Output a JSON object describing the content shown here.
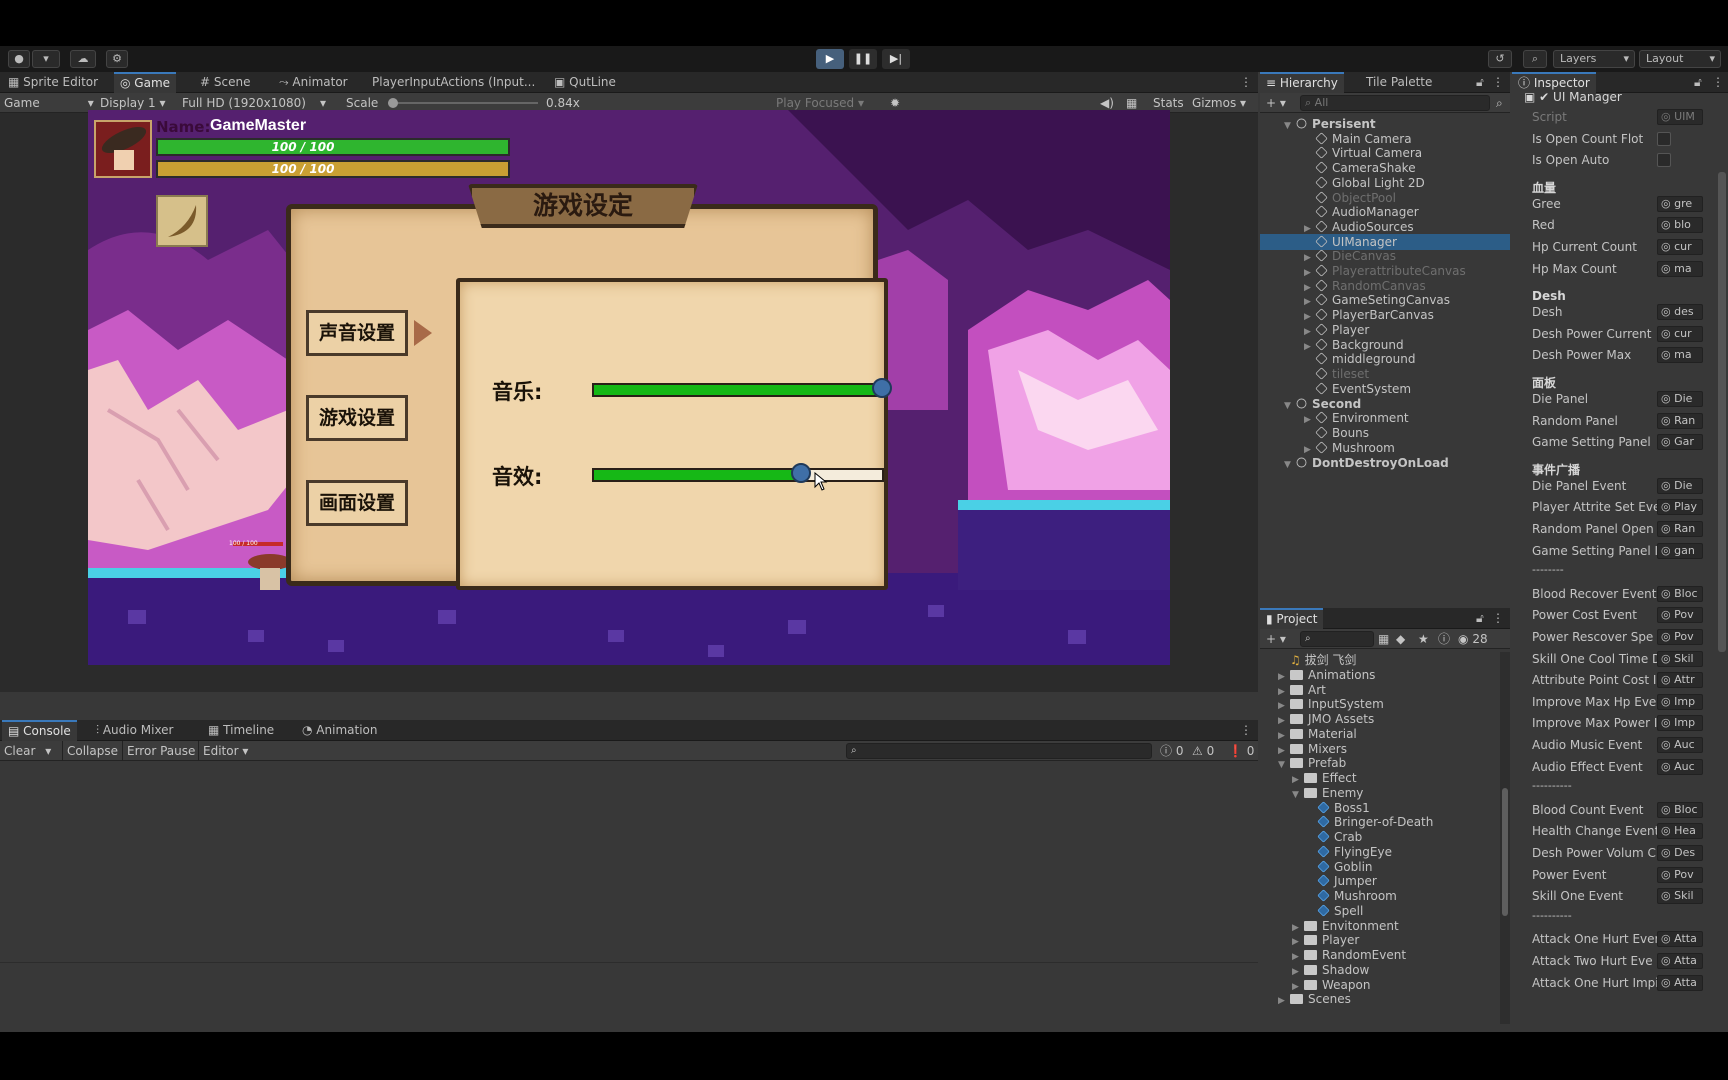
{
  "toolbar": {
    "layers_label": "Layers",
    "layout_label": "Layout"
  },
  "colors": {
    "accent": "#3a79bb",
    "health": "#2fb52f",
    "power": "#c9a033",
    "parchment": "#e8c99b",
    "slider_fill": "#16b816",
    "knob": "#3f6fa7"
  },
  "left_tabs": [
    "Sprite Editor",
    "Game",
    "Scene",
    "Animator",
    "PlayerInputActions (Input...",
    "QutLine"
  ],
  "game_bar": {
    "mode": "Game",
    "display": "Display 1",
    "resolution": "Full HD (1920x1080)",
    "scale_label": "Scale",
    "scale_value": "0.84x",
    "play_focused": "Play Focused",
    "stats": "Stats",
    "gizmos": "Gizmos"
  },
  "game": {
    "name_label": "Name:",
    "player_name": "GameMaster",
    "hp_text": "100 / 100",
    "power_text": "100 / 100",
    "hp_fraction": 1.0,
    "power_fraction": 1.0,
    "enemy_hp_text": "100 / 100",
    "panel_title": "游戏设定",
    "menu": [
      "声音设置",
      "游戏设置",
      "画面设置"
    ],
    "music_label": "音乐:",
    "sfx_label": "音效:",
    "music_fraction": 1.0,
    "sfx_fraction": 0.72
  },
  "console": {
    "tabs": [
      "Console",
      "Audio Mixer",
      "Timeline",
      "Animation"
    ],
    "clear": "Clear",
    "collapse": "Collapse",
    "error_pause": "Error Pause",
    "editor": "Editor",
    "count_info": "0",
    "count_warn": "0",
    "count_err": "0"
  },
  "hierarchy": {
    "tabs": [
      "Hierarchy",
      "Tile Palette"
    ],
    "search_placeholder": "All",
    "rows": [
      {
        "label": "Persisent",
        "scene": true
      },
      {
        "label": "Main Camera"
      },
      {
        "label": "Virtual Camera"
      },
      {
        "label": "CameraShake"
      },
      {
        "label": "Global Light 2D"
      },
      {
        "label": "ObjectPool",
        "dim": true
      },
      {
        "label": "AudioManager"
      },
      {
        "label": "AudioSources",
        "arrow": true
      },
      {
        "label": "UIManager",
        "sel": true
      },
      {
        "label": "DieCanvas",
        "dim": true,
        "arrow": true
      },
      {
        "label": "PlayerattributeCanvas",
        "dim": true,
        "arrow": true
      },
      {
        "label": "RandomCanvas",
        "dim": true,
        "arrow": true
      },
      {
        "label": "GameSetingCanvas",
        "arrow": true
      },
      {
        "label": "PlayerBarCanvas",
        "arrow": true
      },
      {
        "label": "Player",
        "arrow": true
      },
      {
        "label": "Background",
        "arrow": true
      },
      {
        "label": "middleground"
      },
      {
        "label": "tileset",
        "dim": true
      },
      {
        "label": "EventSystem"
      },
      {
        "label": "Second",
        "scene": true
      },
      {
        "label": "Environment",
        "arrow": true
      },
      {
        "label": "Bouns"
      },
      {
        "label": "Mushroom",
        "arrow": true
      },
      {
        "label": "DontDestroyOnLoad",
        "scene": true
      }
    ]
  },
  "project": {
    "tab": "Project",
    "count": "28",
    "rows": [
      {
        "label": "拔剑 飞剑",
        "kind": "audio",
        "indent": 0
      },
      {
        "label": "Animations",
        "kind": "folder",
        "indent": 0
      },
      {
        "label": "Art",
        "kind": "folder",
        "indent": 0
      },
      {
        "label": "InputSystem",
        "kind": "folder",
        "indent": 0
      },
      {
        "label": "JMO Assets",
        "kind": "folder",
        "indent": 0
      },
      {
        "label": "Material",
        "kind": "folder",
        "indent": 0
      },
      {
        "label": "Mixers",
        "kind": "folder",
        "indent": 0
      },
      {
        "label": "Prefab",
        "kind": "folder",
        "indent": 0,
        "open": true
      },
      {
        "label": "Effect",
        "kind": "folder",
        "indent": 1
      },
      {
        "label": "Enemy",
        "kind": "folder",
        "indent": 1,
        "open": true
      },
      {
        "label": "Boss1",
        "kind": "prefab",
        "indent": 2
      },
      {
        "label": "Bringer-of-Death",
        "kind": "prefab",
        "indent": 2
      },
      {
        "label": "Crab",
        "kind": "prefab",
        "indent": 2
      },
      {
        "label": "FlyingEye",
        "kind": "prefab",
        "indent": 2
      },
      {
        "label": "Goblin",
        "kind": "prefab",
        "indent": 2
      },
      {
        "label": "Jumper",
        "kind": "prefab",
        "indent": 2
      },
      {
        "label": "Mushroom",
        "kind": "prefab",
        "indent": 2
      },
      {
        "label": "Spell",
        "kind": "prefab",
        "indent": 2
      },
      {
        "label": "Envitonment",
        "kind": "folder",
        "indent": 1
      },
      {
        "label": "Player",
        "kind": "folder",
        "indent": 1
      },
      {
        "label": "RandomEvent",
        "kind": "folder",
        "indent": 1
      },
      {
        "label": "Shadow",
        "kind": "folder",
        "indent": 1
      },
      {
        "label": "Weapon",
        "kind": "folder",
        "indent": 1
      },
      {
        "label": "Scenes",
        "kind": "folder",
        "indent": 0
      }
    ]
  },
  "inspector": {
    "tab": "Inspector",
    "component": "UI Manager",
    "rows": [
      {
        "type": "field",
        "label": "Script",
        "value": "UIM",
        "dim": true
      },
      {
        "type": "check",
        "label": "Is Open Count Flot"
      },
      {
        "type": "check",
        "label": "Is Open Auto"
      },
      {
        "type": "head",
        "label": "血量"
      },
      {
        "type": "field",
        "label": "Gree",
        "value": "gre"
      },
      {
        "type": "field",
        "label": "Red",
        "value": "blo"
      },
      {
        "type": "field",
        "label": "Hp Current Count",
        "value": "cur"
      },
      {
        "type": "field",
        "label": "Hp Max Count",
        "value": "ma"
      },
      {
        "type": "head",
        "label": "Desh"
      },
      {
        "type": "field",
        "label": "Desh",
        "value": "des"
      },
      {
        "type": "field",
        "label": "Desh Power Current",
        "value": "cur"
      },
      {
        "type": "field",
        "label": "Desh Power Max",
        "value": "ma"
      },
      {
        "type": "head",
        "label": "面板"
      },
      {
        "type": "field",
        "label": "Die Panel",
        "value": "Die"
      },
      {
        "type": "field",
        "label": "Random Panel",
        "value": "Ran"
      },
      {
        "type": "field",
        "label": "Game Setting Panel",
        "value": "Gar"
      },
      {
        "type": "head",
        "label": "事件广播"
      },
      {
        "type": "field",
        "label": "Die Panel Event",
        "value": "Die"
      },
      {
        "type": "field",
        "label": "Player Attrite Set Eve",
        "value": "Play"
      },
      {
        "type": "field",
        "label": "Random Panel Open",
        "value": "Ran"
      },
      {
        "type": "field",
        "label": "Game Setting Panel I",
        "value": "gan"
      },
      {
        "type": "sep",
        "label": "--------"
      },
      {
        "type": "field",
        "label": "Blood Recover Event",
        "value": "Bloc"
      },
      {
        "type": "field",
        "label": "Power Cost Event",
        "value": "Pov"
      },
      {
        "type": "field",
        "label": "Power Rescover Spe",
        "value": "Pov"
      },
      {
        "type": "field",
        "label": "Skill One Cool Time D",
        "value": "Skil"
      },
      {
        "type": "field",
        "label": "Attribute Point Cost I",
        "value": "Attr"
      },
      {
        "type": "field",
        "label": "Improve Max Hp Eve",
        "value": "Imp"
      },
      {
        "type": "field",
        "label": "Improve Max Power I",
        "value": "Imp"
      },
      {
        "type": "field",
        "label": "Audio Music Event",
        "value": "Auc"
      },
      {
        "type": "field",
        "label": "Audio Effect Event",
        "value": "Auc"
      },
      {
        "type": "sep",
        "label": "----------"
      },
      {
        "type": "field",
        "label": "Blood Count Event",
        "value": "Bloc"
      },
      {
        "type": "field",
        "label": "Health Change Event",
        "value": "Hea"
      },
      {
        "type": "field",
        "label": "Desh Power Volum C",
        "value": "Des"
      },
      {
        "type": "field",
        "label": "Power Event",
        "value": "Pov"
      },
      {
        "type": "field",
        "label": "Skill One Event",
        "value": "Skil"
      },
      {
        "type": "sep",
        "label": "----------"
      },
      {
        "type": "field",
        "label": "Attack One Hurt Ever",
        "value": "Atta"
      },
      {
        "type": "field",
        "label": "Attack Two Hurt Eve",
        "value": "Atta"
      },
      {
        "type": "field",
        "label": "Attack One Hurt Impi",
        "value": "Atta"
      }
    ]
  }
}
